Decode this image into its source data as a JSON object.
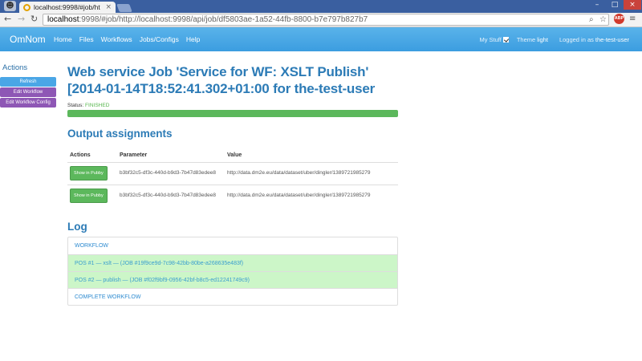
{
  "browser": {
    "tab_title": "localhost:9998/#job/ht",
    "url_host": "localhost",
    "url_rest": ":9998/#job/http://localhost:9998/api/job/df5803ae-1a52-44fb-8800-b7e797b827b7",
    "extension_label": "ABP"
  },
  "navbar": {
    "brand": "OmNom",
    "links": [
      "Home",
      "Files",
      "Workflows",
      "Jobs/Configs",
      "Help"
    ],
    "my_stuff_label": "My Stuff",
    "theme_label": "Theme",
    "theme_value": "light",
    "logged_in_label": "Logged in as",
    "user": "the-test-user"
  },
  "sidebar": {
    "title": "Actions",
    "buttons": [
      "Refresh",
      "Edit Workflow",
      "Edit Workflow Config"
    ]
  },
  "main": {
    "title": "Web service Job 'Service for WF: XSLT Publish' [2014-01-14T18:52:41.302+01:00 for the-test-user",
    "status_label": "Status:",
    "status_value": "FINISHED",
    "progress": 1.0,
    "output_heading": "Output assignments",
    "columns": [
      "Actions",
      "Parameter",
      "Value"
    ],
    "rows": [
      {
        "action": "Show in Pubby",
        "parameter": "b3bf32c5-df3c-440d-b9d3-7b47d83edee8",
        "value": "http://data.dm2e.eu/data/dataset/uber/dingler/1389721985279"
      },
      {
        "action": "Show in Pubby",
        "parameter": "b3bf32c5-df3c-440d-b9d3-7b47d83edee8",
        "value": "http://data.dm2e.eu/data/dataset/uber/dingler/1389721985279"
      }
    ],
    "log_heading": "Log",
    "log_items": [
      "WORKFLOW",
      "POS #1 — xslt — (JOB #19f9ce9d-7c98-42bb-80be-a268635e483f)",
      "POS #2 — publish — (JOB #f02f9bf9-0956-42bf-b8c5-ed12241749c9)",
      "COMPLETE WORKFLOW"
    ]
  },
  "colors": {
    "navbar": "#3b9de0",
    "heading": "#2c7bb6",
    "success": "#5cb85c",
    "log_success_bg": "#ccf6c8",
    "sidebar_blue": "#4aa6e6",
    "sidebar_purple": "#8e57b5"
  }
}
